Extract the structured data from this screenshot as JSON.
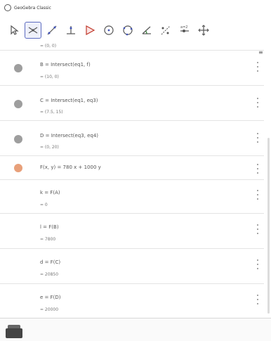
{
  "window": {
    "title": "GeoGebra Classic"
  },
  "toolbar": {
    "tools": [
      {
        "name": "move-tool",
        "active": false
      },
      {
        "name": "intersect-tool",
        "active": true
      },
      {
        "name": "line-tool",
        "active": false
      },
      {
        "name": "perpendicular-tool",
        "active": false
      },
      {
        "name": "polygon-tool",
        "active": false
      },
      {
        "name": "circle-tool",
        "active": false
      },
      {
        "name": "circle-three-points-tool",
        "active": false
      },
      {
        "name": "angle-tool",
        "active": false
      },
      {
        "name": "reflect-tool",
        "active": false
      },
      {
        "name": "slider-tool",
        "active": false
      },
      {
        "name": "move-graphics-tool",
        "active": false
      }
    ]
  },
  "algebra": {
    "top_partial_value": "= (0, 0)",
    "rows": [
      {
        "def": "B = Intersect(eq1, f)",
        "value": "= (10, 0)",
        "marble": "#9e9e9e"
      },
      {
        "def": "C = Intersect(eq1, eq3)",
        "value": "= (7.5, 15)",
        "marble": "#9e9e9e"
      },
      {
        "def": "D = Intersect(eq3, eq4)",
        "value": "= (0, 20)",
        "marble": "#9e9e9e"
      },
      {
        "def": "F(x, y) = 780 x + 1000 y",
        "value": "",
        "marble": "#e8a07a"
      },
      {
        "def": "k = F(A)",
        "value": "= 0",
        "marble": ""
      },
      {
        "def": "l = F(B)",
        "value": "= 7800",
        "marble": ""
      },
      {
        "def": "d = F(C)",
        "value": "= 20850",
        "marble": ""
      },
      {
        "def": "e = F(D)",
        "value": "= 20000",
        "marble": ""
      }
    ]
  }
}
